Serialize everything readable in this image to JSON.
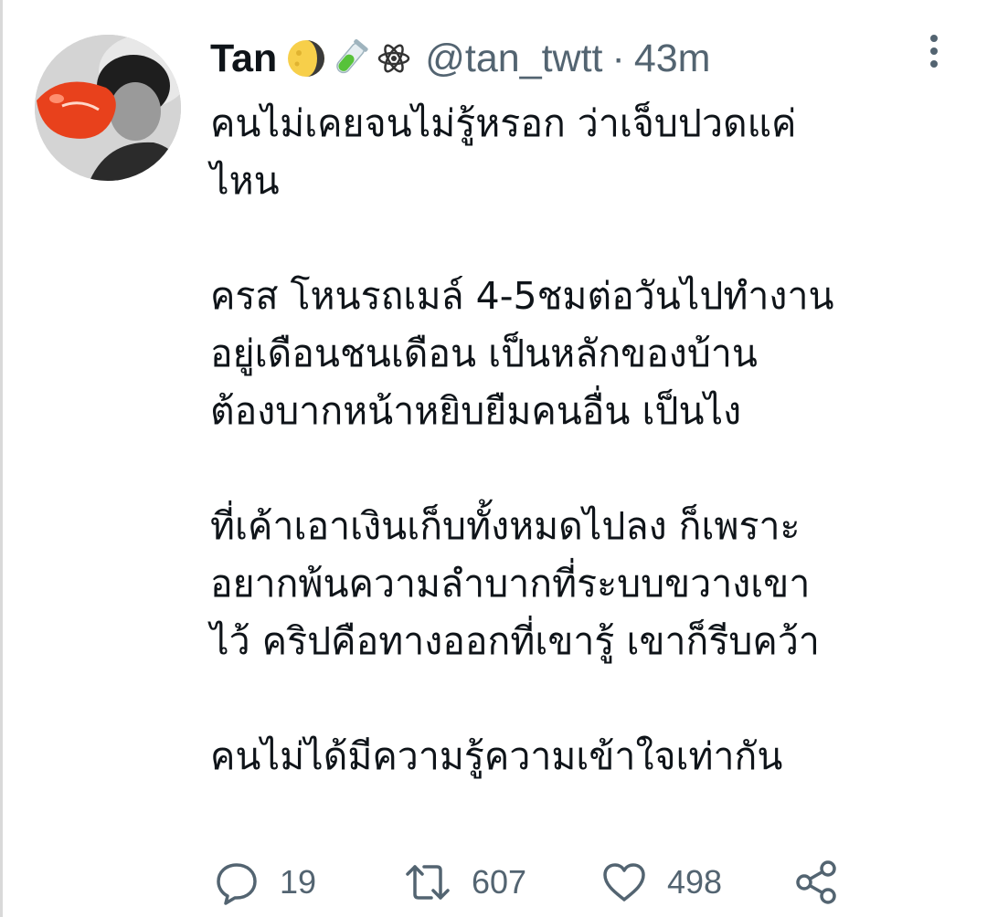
{
  "tweet": {
    "author": {
      "name": "Tan",
      "emojis": [
        "moon-emoji",
        "test-tube-emoji",
        "atom-emoji"
      ],
      "handle": "@tan_twtt",
      "separator": "·",
      "time": "43m"
    },
    "text_lines": [
      "คนไม่เคยจนไม่รู้หรอก ว่าเจ็บปวดแค่",
      "ไหน",
      "",
      "ครส โหนรถเมล์ 4-5ชมต่อวันไปทำงาน",
      "อยู่เดือนชนเดือน เป็นหลักของบ้าน",
      "ต้องบากหน้าหยิบยืมคนอื่น เป็นไง",
      "",
      "ที่เค้าเอาเงินเก็บทั้งหมดไปลง ก็เพราะ",
      "อยากพ้นความลำบากที่ระบบขวางเขา",
      "ไว้ คริปคือทางออกที่เขารู้ เขาก็รีบคว้า",
      "",
      "คนไม่ได้มีความรู้ความเข้าใจเท่ากัน"
    ],
    "actions": {
      "replies": "19",
      "retweets": "607",
      "likes": "498"
    }
  },
  "colors": {
    "text": "#0f1419",
    "secondary": "#536471"
  }
}
